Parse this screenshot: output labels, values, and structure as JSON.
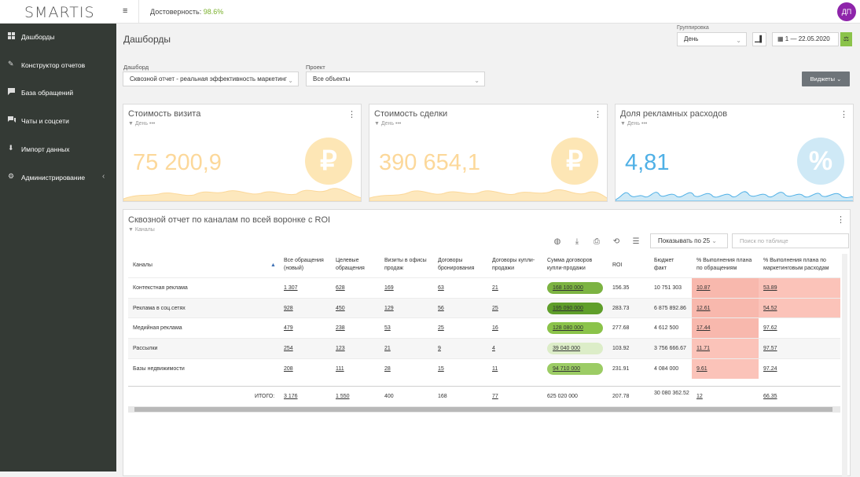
{
  "brand": "SMARTIS",
  "header": {
    "menu_icon": "≡",
    "reliability_label": "Достоверность:",
    "reliability_value": "98.6%",
    "avatar_initials": "ДП"
  },
  "sidebar": {
    "items": [
      {
        "label": "Дашборды",
        "icon": "dashboard-icon"
      },
      {
        "label": "Конструктор отчетов",
        "icon": "wrench-icon"
      },
      {
        "label": "База обращений",
        "icon": "chat-icon"
      },
      {
        "label": "Чаты и соцсети",
        "icon": "chats-icon"
      },
      {
        "label": "Импорт данных",
        "icon": "download-icon"
      },
      {
        "label": "Администрирование",
        "icon": "gear-icon"
      }
    ]
  },
  "page": {
    "title": "Дашборды"
  },
  "grouping": {
    "label": "Группировка",
    "value": "День"
  },
  "daterange": {
    "value": "1 — 22.05.2020"
  },
  "filters": {
    "dashboard_label": "Дашборд",
    "dashboard_value": "Сквозной отчет - реальная эффективность маркетинг",
    "project_label": "Проект",
    "project_value": "Все объекты"
  },
  "widgets_button": "Виджеты",
  "kpis": [
    {
      "title": "Стоимость визита",
      "sub": "День",
      "value": "75 200,9",
      "symbol": "₽",
      "color": "#fde6b5",
      "text": "#fcd89a"
    },
    {
      "title": "Стоимость сделки",
      "sub": "День",
      "value": "390 654,1",
      "symbol": "₽",
      "color": "#fde6b5",
      "text": "#fcd89a"
    },
    {
      "title": "Доля рекламных расходов",
      "sub": "День",
      "value": "4,81",
      "symbol": "%",
      "color": "#cfe9f6",
      "text": "#4fb0e6"
    }
  ],
  "table": {
    "title": "Сквозной отчет по каналам по всей воронке с ROI",
    "sub": "Каналы",
    "show_label": "Показывать по 25",
    "search_placeholder": "Поиск по таблице",
    "headers": [
      "Каналы",
      "Все обращения (новый)",
      "Целевые обращения",
      "Визиты в офисы продаж",
      "Договоры бронирования",
      "Договоры купли-продажи",
      "Сумма договоров купли-продажи",
      "ROI",
      "Бюджет факт",
      "% Выполнения плана по обращениям",
      "% Выполнения плана по маркетинговым расходам"
    ],
    "rows": [
      [
        "Контекстная реклама",
        "1 307",
        "628",
        "169",
        "63",
        "21",
        "168 100 000",
        "156.35",
        "10 751 303",
        "10.87",
        "53.89"
      ],
      [
        "Реклама в соц.сетях",
        "928",
        "450",
        "129",
        "56",
        "25",
        "195 090 000",
        "283.73",
        "6 875 892.86",
        "12.61",
        "54.52"
      ],
      [
        "Медийная реклама",
        "479",
        "238",
        "53",
        "25",
        "16",
        "128 080 000",
        "277.68",
        "4 612 500",
        "17.44",
        "97.62"
      ],
      [
        "Рассылки",
        "254",
        "123",
        "21",
        "9",
        "4",
        "39 040 000",
        "103.92",
        "3 756 666.67",
        "11.71",
        "97.57"
      ],
      [
        "Базы недвижимости",
        "208",
        "111",
        "28",
        "15",
        "11",
        "94 710 000",
        "231.91",
        "4 084 000",
        "9.61",
        "97.24"
      ]
    ],
    "total": [
      "ИТОГО:",
      "3 176",
      "1 550",
      "400",
      "168",
      "77",
      "625 020 000",
      "207.78",
      "30 080 362.52",
      "12",
      "66.35"
    ],
    "pill_colors": [
      "#7cb342",
      "#5f9e2a",
      "#8bc34a",
      "#dcedc8",
      "#9ccc65"
    ]
  }
}
